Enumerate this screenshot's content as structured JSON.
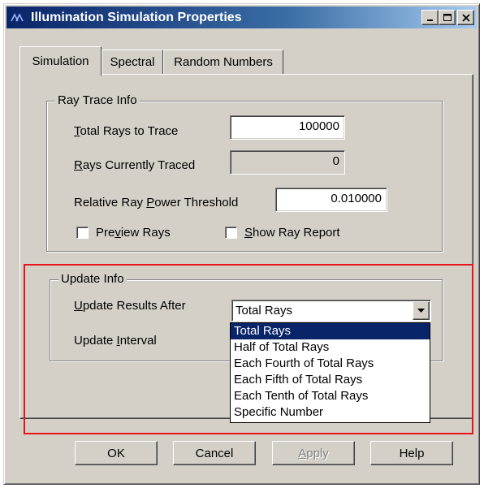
{
  "window": {
    "title": "Illumination Simulation Properties",
    "controls": {
      "minimize": "minimize",
      "maximize": "maximize",
      "close": "close"
    }
  },
  "tabs": [
    {
      "label": "Simulation",
      "active": true
    },
    {
      "label": "Spectral",
      "active": false
    },
    {
      "label": "Random Numbers",
      "active": false
    }
  ],
  "ray_trace_info": {
    "group_label": "Ray Trace Info",
    "total_rays": {
      "label_pre": "",
      "label_mnemonic": "T",
      "label_post": "otal Rays to Trace",
      "value": "100000"
    },
    "rays_traced": {
      "label_pre": "",
      "label_mnemonic": "R",
      "label_post": "ays Currently Traced",
      "value": "0"
    },
    "power_threshold": {
      "label_pre": "Relative Ray ",
      "label_mnemonic": "P",
      "label_post": "ower Threshold",
      "value": "0.010000"
    },
    "preview_rays": {
      "label_pre": "Pre",
      "label_mnemonic": "v",
      "label_post": "iew Rays",
      "checked": false
    },
    "show_ray_report": {
      "label_pre": "",
      "label_mnemonic": "S",
      "label_post": "how Ray Report",
      "checked": false
    }
  },
  "update_info": {
    "group_label": "Update Info",
    "update_after": {
      "label_pre": "",
      "label_mnemonic": "U",
      "label_post": "pdate Results After",
      "value": "Total Rays"
    },
    "update_interval": {
      "label_pre": "Update ",
      "label_mnemonic": "I",
      "label_post": "nterval"
    },
    "dropdown_options": [
      "Total Rays",
      "Half of Total Rays",
      "Each Fourth of Total Rays",
      "Each Fifth of Total Rays",
      "Each Tenth of Total Rays",
      "Specific Number"
    ],
    "selected_index": 0
  },
  "buttons": {
    "ok": "OK",
    "cancel": "Cancel",
    "apply_pre": "",
    "apply_mnemonic": "A",
    "apply_post": "pply",
    "help": "Help"
  },
  "colors": {
    "highlight": "#e8131b",
    "titlebar": "#0a246a",
    "face": "#d4d0c8"
  }
}
